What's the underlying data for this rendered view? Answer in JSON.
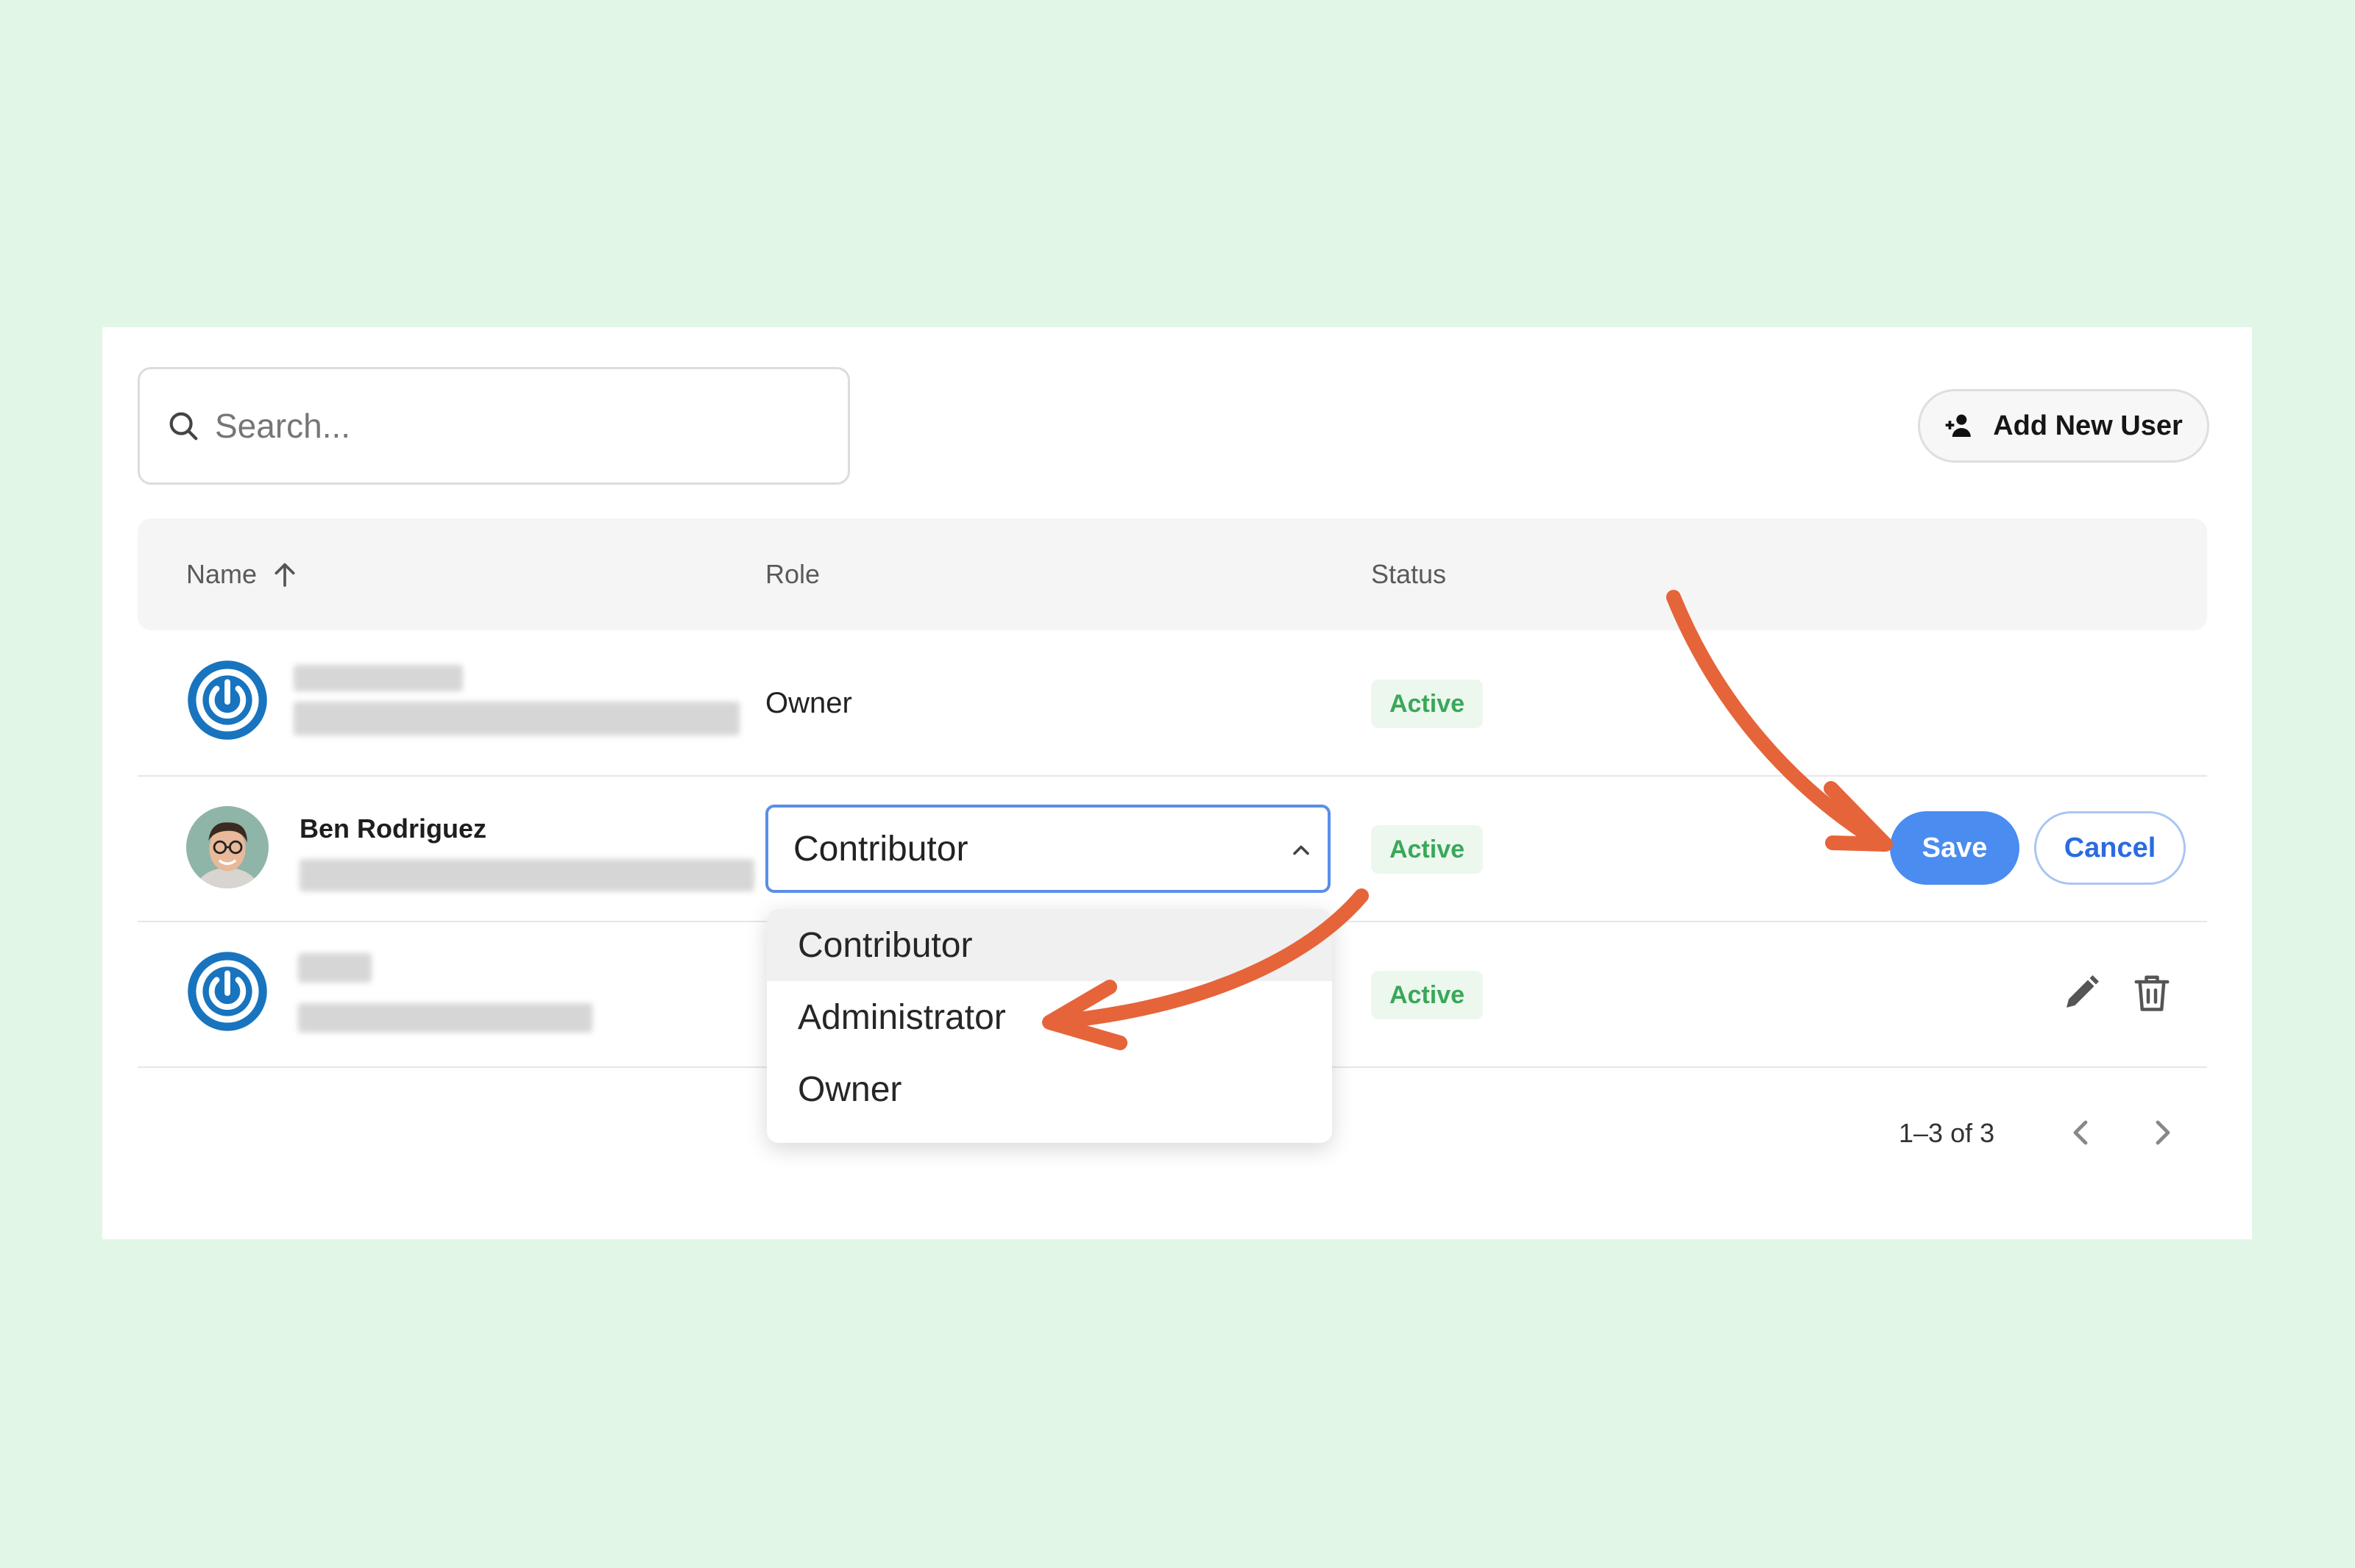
{
  "search": {
    "placeholder": "Search..."
  },
  "toolbar": {
    "add_user_label": "Add New User"
  },
  "table": {
    "headers": {
      "name": "Name",
      "role": "Role",
      "status": "Status"
    },
    "rows": [
      {
        "name": "",
        "role": "Owner",
        "status": "Active"
      },
      {
        "name": "Ben Rodriguez",
        "role": "Contributor",
        "status": "Active"
      },
      {
        "name": "",
        "role": "",
        "status": "Active"
      }
    ]
  },
  "role_select": {
    "value": "Contributor",
    "options": [
      "Contributor",
      "Administrator",
      "Owner"
    ]
  },
  "actions": {
    "save_label": "Save",
    "cancel_label": "Cancel"
  },
  "pagination": {
    "range_label": "1–3 of 3"
  },
  "icons": {
    "search": "search-icon",
    "add_user": "add-user-icon",
    "sort": "sort-ascending-icon",
    "edit": "pencil-icon",
    "delete": "trash-icon",
    "chevron_up": "chevron-up-icon",
    "prev": "chevron-left-icon",
    "next": "chevron-right-icon"
  },
  "colors": {
    "page_bg": "#e1f6e6",
    "accent": "#4a8cf0",
    "status_active": "#3aa75a",
    "annotation_arrow": "#e6643a"
  }
}
